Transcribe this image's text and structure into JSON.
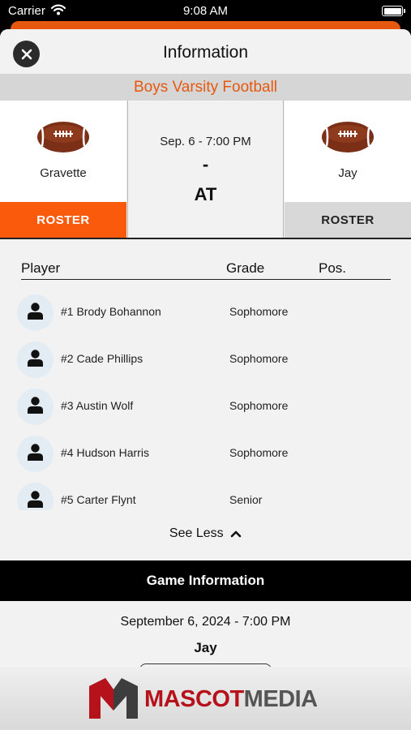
{
  "status_bar": {
    "carrier": "Carrier",
    "time": "9:08 AM"
  },
  "header": {
    "title": "Information"
  },
  "sport": "Boys Varsity Football",
  "matchup": {
    "home_team": {
      "name": "Gravette",
      "roster_label": "ROSTER",
      "icon": "football-icon"
    },
    "away_team": {
      "name": "Jay",
      "roster_label": "ROSTER",
      "icon": "football-icon"
    },
    "date_time": "Sep. 6 - 7:00 PM",
    "separator": "-",
    "vs_text": "AT"
  },
  "roster": {
    "columns": {
      "player": "Player",
      "grade": "Grade",
      "position": "Pos."
    },
    "players": [
      {
        "name": "#1 Brody Bohannon",
        "grade": "Sophomore",
        "position": ""
      },
      {
        "name": "#2 Cade Phillips",
        "grade": "Sophomore",
        "position": ""
      },
      {
        "name": "#3 Austin Wolf",
        "grade": "Sophomore",
        "position": ""
      },
      {
        "name": "#4 Hudson Harris",
        "grade": "Sophomore",
        "position": ""
      },
      {
        "name": "#5 Carter Flynt",
        "grade": "Senior",
        "position": ""
      }
    ],
    "toggle_label": "See Less"
  },
  "game_information": {
    "heading": "Game Information",
    "date_time": "September 6, 2024 - 7:00 PM",
    "opponent": "Jay"
  },
  "footer": {
    "brand_part1": "MASCOT",
    "brand_part2": "MEDIA"
  },
  "colors": {
    "accent": "#fa5a0c",
    "brand_red": "#b5121b",
    "dark": "#000000"
  }
}
